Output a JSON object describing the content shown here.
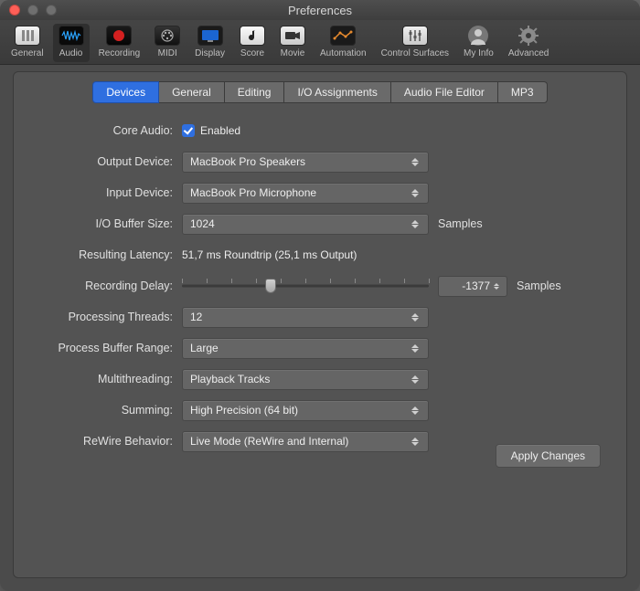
{
  "window": {
    "title": "Preferences"
  },
  "toolbar": {
    "items": [
      {
        "name": "general",
        "label": "General"
      },
      {
        "name": "audio",
        "label": "Audio"
      },
      {
        "name": "recording",
        "label": "Recording"
      },
      {
        "name": "midi",
        "label": "MIDI"
      },
      {
        "name": "display",
        "label": "Display"
      },
      {
        "name": "score",
        "label": "Score"
      },
      {
        "name": "movie",
        "label": "Movie"
      },
      {
        "name": "automation",
        "label": "Automation"
      },
      {
        "name": "ctrl",
        "label": "Control Surfaces"
      },
      {
        "name": "myinfo",
        "label": "My Info"
      },
      {
        "name": "advanced",
        "label": "Advanced"
      }
    ],
    "selected": "audio"
  },
  "tabs": {
    "items": [
      "Devices",
      "General",
      "Editing",
      "I/O Assignments",
      "Audio File Editor",
      "MP3"
    ],
    "active": "Devices"
  },
  "form": {
    "coreaudio_label": "Core Audio:",
    "coreaudio_value_text": "Enabled",
    "output_label": "Output Device:",
    "output_value": "MacBook Pro Speakers",
    "input_label": "Input Device:",
    "input_value": "MacBook Pro Microphone",
    "buffer_label": "I/O Buffer Size:",
    "buffer_value": "1024",
    "buffer_suffix": "Samples",
    "latency_label": "Resulting Latency:",
    "latency_value": "51,7 ms Roundtrip (25,1 ms Output)",
    "recdelay_label": "Recording Delay:",
    "recdelay_value": "-1377",
    "recdelay_suffix": "Samples",
    "threads_label": "Processing Threads:",
    "threads_value": "12",
    "range_label": "Process Buffer Range:",
    "range_value": "Large",
    "mt_label": "Multithreading:",
    "mt_value": "Playback Tracks",
    "sum_label": "Summing:",
    "sum_value": "High Precision (64 bit)",
    "rewire_label": "ReWire Behavior:",
    "rewire_value": "Live Mode (ReWire and Internal)"
  },
  "buttons": {
    "apply": "Apply Changes"
  }
}
